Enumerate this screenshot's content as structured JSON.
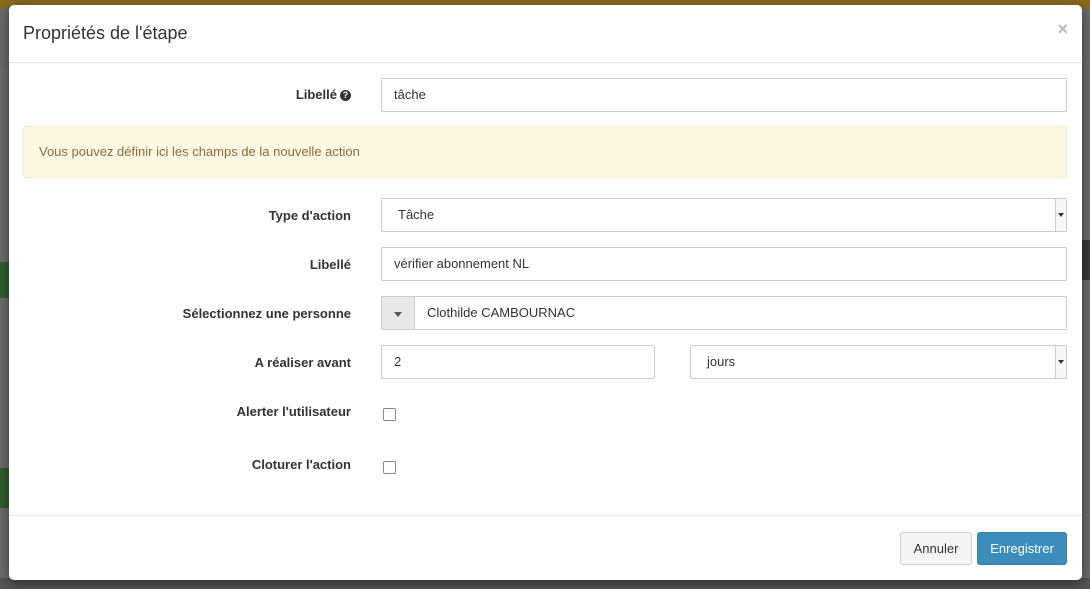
{
  "modal": {
    "title": "Propriétés de l'étape",
    "close_glyph": "×"
  },
  "step": {
    "label_label": "Libellé",
    "label_value": "tâche",
    "help_icon": "question-circle-icon"
  },
  "alert": {
    "text": "Vous pouvez définir ici les champs de la nouvelle action"
  },
  "action": {
    "type_label": "Type d'action",
    "type_value": "Tâche",
    "label_label": "Libellé",
    "label_value": "vérifier abonnement NL",
    "person_label": "Sélectionnez une personne",
    "person_value": "Clothilde CAMBOURNAC",
    "before_label": "A réaliser avant",
    "before_value": "2",
    "before_unit": "jours",
    "alert_user_label": "Alerter l'utilisateur",
    "alert_user_checked": false,
    "close_action_label": "Cloturer l'action",
    "close_action_checked": false
  },
  "footer": {
    "cancel_label": "Annuler",
    "save_label": "Enregistrer"
  },
  "colors": {
    "primary": "#3c8dbc",
    "alert_bg": "#fcf8e3",
    "alert_text": "#8a6d3b"
  }
}
